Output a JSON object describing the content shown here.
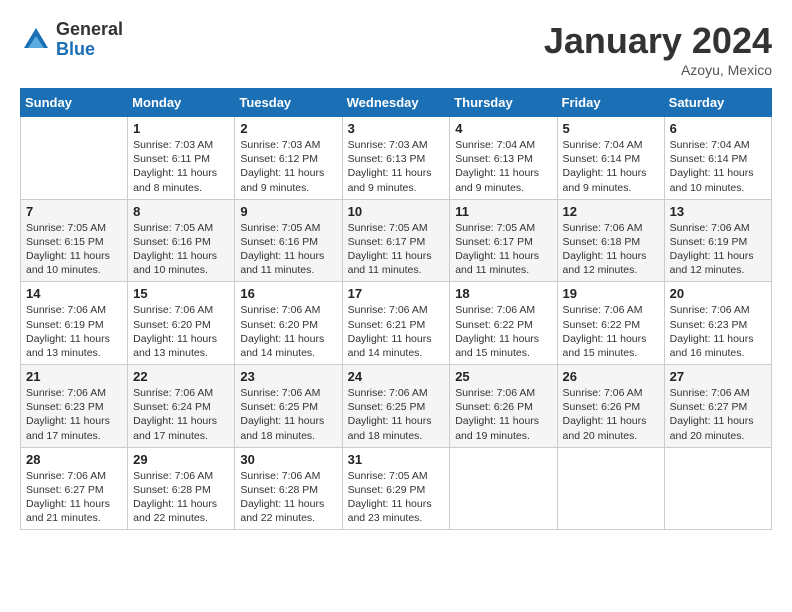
{
  "logo": {
    "general": "General",
    "blue": "Blue"
  },
  "title": "January 2024",
  "location": "Azoyu, Mexico",
  "days_header": [
    "Sunday",
    "Monday",
    "Tuesday",
    "Wednesday",
    "Thursday",
    "Friday",
    "Saturday"
  ],
  "weeks": [
    [
      {
        "day": "",
        "info": ""
      },
      {
        "day": "1",
        "info": "Sunrise: 7:03 AM\nSunset: 6:11 PM\nDaylight: 11 hours\nand 8 minutes."
      },
      {
        "day": "2",
        "info": "Sunrise: 7:03 AM\nSunset: 6:12 PM\nDaylight: 11 hours\nand 9 minutes."
      },
      {
        "day": "3",
        "info": "Sunrise: 7:03 AM\nSunset: 6:13 PM\nDaylight: 11 hours\nand 9 minutes."
      },
      {
        "day": "4",
        "info": "Sunrise: 7:04 AM\nSunset: 6:13 PM\nDaylight: 11 hours\nand 9 minutes."
      },
      {
        "day": "5",
        "info": "Sunrise: 7:04 AM\nSunset: 6:14 PM\nDaylight: 11 hours\nand 9 minutes."
      },
      {
        "day": "6",
        "info": "Sunrise: 7:04 AM\nSunset: 6:14 PM\nDaylight: 11 hours\nand 10 minutes."
      }
    ],
    [
      {
        "day": "7",
        "info": "Daylight: 11 hours\nand 10 minutes."
      },
      {
        "day": "8",
        "info": "Sunrise: 7:05 AM\nSunset: 6:16 PM\nDaylight: 11 hours\nand 10 minutes."
      },
      {
        "day": "9",
        "info": "Sunrise: 7:05 AM\nSunset: 6:16 PM\nDaylight: 11 hours\nand 11 minutes."
      },
      {
        "day": "10",
        "info": "Sunrise: 7:05 AM\nSunset: 6:17 PM\nDaylight: 11 hours\nand 11 minutes."
      },
      {
        "day": "11",
        "info": "Sunrise: 7:05 AM\nSunset: 6:17 PM\nDaylight: 11 hours\nand 11 minutes."
      },
      {
        "day": "12",
        "info": "Sunrise: 7:06 AM\nSunset: 6:18 PM\nDaylight: 11 hours\nand 12 minutes."
      },
      {
        "day": "13",
        "info": "Sunrise: 7:06 AM\nSunset: 6:19 PM\nDaylight: 11 hours\nand 12 minutes."
      }
    ],
    [
      {
        "day": "14",
        "info": "Sunrise: 7:06 AM\nSunset: 6:19 PM\nDaylight: 11 hours\nand 13 minutes."
      },
      {
        "day": "15",
        "info": "Sunrise: 7:06 AM\nSunset: 6:20 PM\nDaylight: 11 hours\nand 13 minutes."
      },
      {
        "day": "16",
        "info": "Sunrise: 7:06 AM\nSunset: 6:20 PM\nDaylight: 11 hours\nand 14 minutes."
      },
      {
        "day": "17",
        "info": "Sunrise: 7:06 AM\nSunset: 6:21 PM\nDaylight: 11 hours\nand 14 minutes."
      },
      {
        "day": "18",
        "info": "Sunrise: 7:06 AM\nSunset: 6:22 PM\nDaylight: 11 hours\nand 15 minutes."
      },
      {
        "day": "19",
        "info": "Sunrise: 7:06 AM\nSunset: 6:22 PM\nDaylight: 11 hours\nand 15 minutes."
      },
      {
        "day": "20",
        "info": "Sunrise: 7:06 AM\nSunset: 6:23 PM\nDaylight: 11 hours\nand 16 minutes."
      }
    ],
    [
      {
        "day": "21",
        "info": "Sunrise: 7:06 AM\nSunset: 6:23 PM\nDaylight: 11 hours\nand 17 minutes."
      },
      {
        "day": "22",
        "info": "Sunrise: 7:06 AM\nSunset: 6:24 PM\nDaylight: 11 hours\nand 17 minutes."
      },
      {
        "day": "23",
        "info": "Sunrise: 7:06 AM\nSunset: 6:25 PM\nDaylight: 11 hours\nand 18 minutes."
      },
      {
        "day": "24",
        "info": "Sunrise: 7:06 AM\nSunset: 6:25 PM\nDaylight: 11 hours\nand 18 minutes."
      },
      {
        "day": "25",
        "info": "Sunrise: 7:06 AM\nSunset: 6:26 PM\nDaylight: 11 hours\nand 19 minutes."
      },
      {
        "day": "26",
        "info": "Sunrise: 7:06 AM\nSunset: 6:26 PM\nDaylight: 11 hours\nand 20 minutes."
      },
      {
        "day": "27",
        "info": "Sunrise: 7:06 AM\nSunset: 6:27 PM\nDaylight: 11 hours\nand 20 minutes."
      }
    ],
    [
      {
        "day": "28",
        "info": "Sunrise: 7:06 AM\nSunset: 6:27 PM\nDaylight: 11 hours\nand 21 minutes."
      },
      {
        "day": "29",
        "info": "Sunrise: 7:06 AM\nSunset: 6:28 PM\nDaylight: 11 hours\nand 22 minutes."
      },
      {
        "day": "30",
        "info": "Sunrise: 7:06 AM\nSunset: 6:28 PM\nDaylight: 11 hours\nand 22 minutes."
      },
      {
        "day": "31",
        "info": "Sunrise: 7:05 AM\nSunset: 6:29 PM\nDaylight: 11 hours\nand 23 minutes."
      },
      {
        "day": "",
        "info": ""
      },
      {
        "day": "",
        "info": ""
      },
      {
        "day": "",
        "info": ""
      }
    ]
  ],
  "week7_sun": "Sunrise: 7:05 AM\nSunset: 6:15 PM\nDaylight: 11 hours\nand 10 minutes."
}
